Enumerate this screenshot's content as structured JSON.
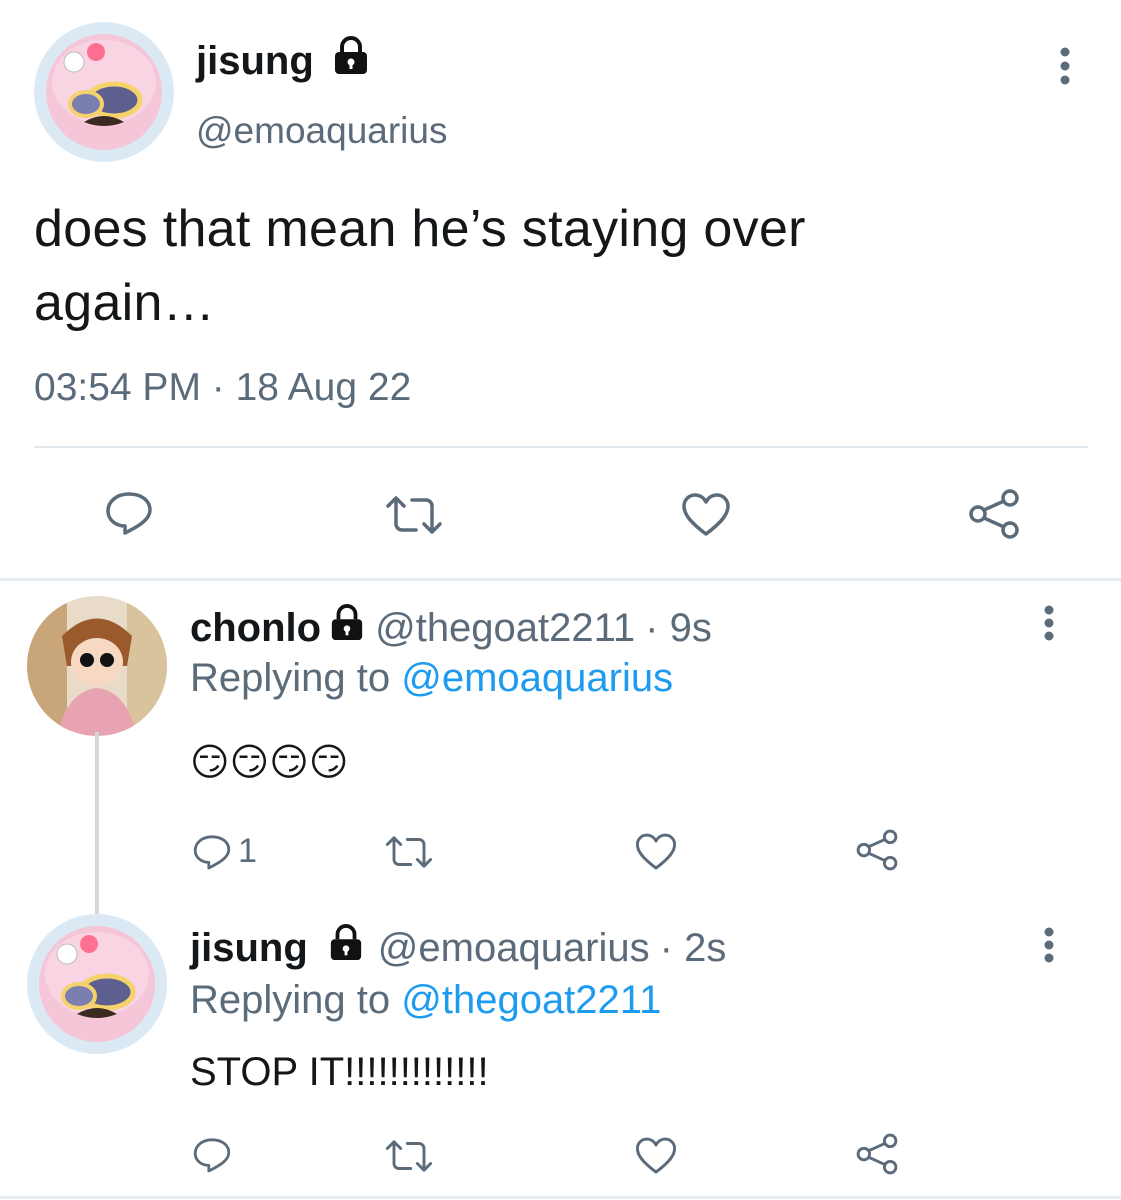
{
  "main_tweet": {
    "name": "jisung",
    "handle": "@emoaquarius",
    "text": "does that mean he’s staying over again…",
    "timestamp": "03:54 PM · 18 Aug 22",
    "actions": [
      "reply-icon",
      "retweet-icon",
      "like-icon",
      "share-icon"
    ]
  },
  "replies": [
    {
      "name": "chonlo",
      "handle": "@thegoat2211",
      "time": "· 9s",
      "replying_prefix": "Replying to ",
      "replying_to": "@emoaquarius",
      "text": "😏😏😏😏",
      "reply_count": "1"
    },
    {
      "name": "jisung",
      "handle": "@emoaquarius",
      "time": "· 2s",
      "replying_prefix": "Replying to ",
      "replying_to": "@thegoat2211",
      "text": "STOP IT!!!!!!!!!!!!!"
    }
  ],
  "colors": {
    "text": "#14171a",
    "secondary": "#5b6b7a",
    "link": "#1d9bf0",
    "divider": "#e1e8ed"
  }
}
